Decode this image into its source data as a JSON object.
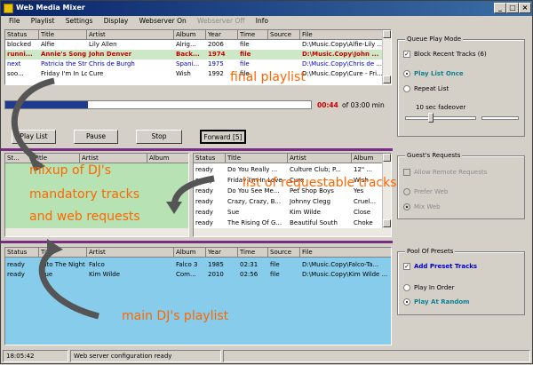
{
  "window": {
    "title": "Web Media Mixer",
    "min": "_",
    "max": "□",
    "close": "×"
  },
  "menu": [
    "File",
    "Playlist",
    "Settings",
    "Display",
    "Webserver On",
    "Webserver Off",
    "Info"
  ],
  "playlist": {
    "columns": [
      "Status",
      "Title",
      "Artist",
      "Album",
      "Year",
      "Time",
      "Source",
      "File"
    ],
    "rows": [
      [
        "blocked",
        "Alfie",
        "Lily Allen",
        "Alrig...",
        "2006",
        "file",
        "",
        "D:\\Music.Copy\\Alfie-Lily ..."
      ],
      [
        "runni...",
        "Annie's Song",
        "John Denver",
        "Back...",
        "1974",
        "file",
        "",
        "D:\\Music.Copy\\John ..."
      ],
      [
        "next",
        "Patricia the Stri...",
        "Chris de Burgh",
        "Spani...",
        "1975",
        "file",
        "",
        "D:\\Music.Copy\\Chris de ..."
      ],
      [
        "soo...",
        "Friday I'm In Love",
        "Cure",
        "Wish",
        "1992",
        "file",
        "",
        "D:\\Music.Copy\\Cure - Fri..."
      ]
    ]
  },
  "progress": {
    "fraction": 0.27,
    "time": "00:44",
    "total_text": "of  03:00  min"
  },
  "controls": {
    "play": "Play List",
    "pause": "Pause",
    "stop": "Stop",
    "forward": "Forward [5]"
  },
  "mix": {
    "columns": [
      "St...",
      "Title",
      "Artist",
      "Album"
    ]
  },
  "requestable": {
    "columns": [
      "Status",
      "Title",
      "Artist",
      "Album"
    ],
    "rows": [
      [
        "ready",
        "Do You Really ...",
        "Culture Club; P...",
        "12\" ..."
      ],
      [
        "ready",
        "Friday I'm In Love",
        "Cure",
        "Wish"
      ],
      [
        "ready",
        "Do You See Me...",
        "Pet Shop Boys",
        "Yes"
      ],
      [
        "ready",
        "Crazy, Crazy, B...",
        "Johnny Clegg",
        "Cruel..."
      ],
      [
        "ready",
        "Sue",
        "Kim Wilde",
        "Close"
      ],
      [
        "ready",
        "The Rising Of G...",
        "Beautiful South",
        "Choke"
      ]
    ]
  },
  "main": {
    "columns": [
      "Status",
      "Title",
      "Artist",
      "Album",
      "Year",
      "Time",
      "Source",
      "File"
    ],
    "rows": [
      [
        "ready",
        "Into The Night",
        "Falco",
        "Falco 3",
        "1985",
        "02:31",
        "file",
        "D:\\Music.Copy\\Falco-Ta..."
      ],
      [
        "ready",
        "Sue",
        "Kim Wilde",
        "Com...",
        "2010",
        "02:56",
        "file",
        "D:\\Music.Copy\\Kim Wilde ..."
      ]
    ]
  },
  "queue": {
    "label": "Queue Play Mode",
    "block": "Block Recent Tracks (6)",
    "once": "Play List Once",
    "repeat": "Repeat List",
    "fade": "10 sec fadeover"
  },
  "guest": {
    "label": "Guest's Requests",
    "allow": "Allow Remote Requests",
    "prefer": "Prefer Web",
    "mix": "Mix Web"
  },
  "presets": {
    "label": "Pool Of Presets",
    "add": "Add Preset Tracks",
    "order": "Play In Order",
    "random": "Play At Random"
  },
  "statusbar": {
    "time": "18:05:42",
    "msg": "Web server configuration ready"
  },
  "notes": {
    "final": "final playlist",
    "mixup1": "mixup of DJ's",
    "mixup2": "mandatory tracks",
    "mixup3": "and web requests",
    "req": "list of requestable tracks",
    "main": "main DJ's playlist"
  },
  "colors": {
    "accent": "#ff6600",
    "selected": "#cde8c6",
    "mixbg": "#b6e2b4",
    "mainbg": "#87ccea",
    "divider": "#7a2d85",
    "running": "#cc0000",
    "next": "#0000cc",
    "teal": "#108090"
  }
}
